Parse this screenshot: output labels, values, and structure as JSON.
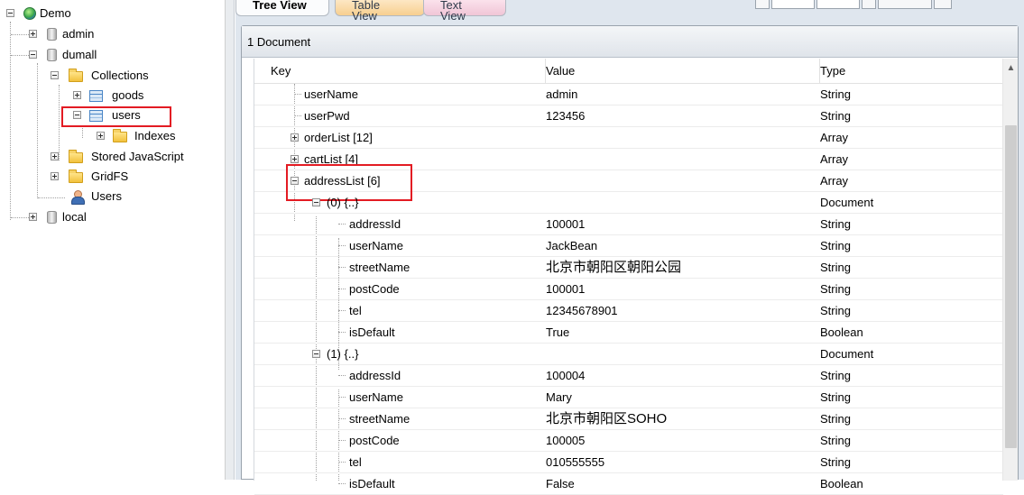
{
  "left_tree": {
    "root": "Demo",
    "admin": "admin",
    "dumall": "dumall",
    "collections": "Collections",
    "goods": "goods",
    "users": "users",
    "indexes": "Indexes",
    "stored_js": "Stored JavaScript",
    "gridfs": "GridFS",
    "users_node": "Users",
    "local": "local"
  },
  "tabs": {
    "tree_view": "Tree View",
    "table_view": "Table View",
    "text_view": "Text View"
  },
  "doc_count": "1 Document",
  "columns": {
    "key": "Key",
    "value": "Value",
    "type": "Type"
  },
  "rows": [
    {
      "key": "userName",
      "value": "admin",
      "type": "String"
    },
    {
      "key": "userPwd",
      "value": "123456",
      "type": "String"
    },
    {
      "key": "orderList [12]",
      "value": "",
      "type": "Array"
    },
    {
      "key": "cartList [4]",
      "value": "",
      "type": "Array"
    },
    {
      "key": "addressList [6]",
      "value": "",
      "type": "Array"
    },
    {
      "key": "(0) {..}",
      "value": "",
      "type": "Document"
    },
    {
      "key": "addressId",
      "value": "100001",
      "type": "String"
    },
    {
      "key": "userName",
      "value": "JackBean",
      "type": "String"
    },
    {
      "key": "streetName",
      "value": "北京市朝阳区朝阳公园",
      "type": "String"
    },
    {
      "key": "postCode",
      "value": "100001",
      "type": "String"
    },
    {
      "key": "tel",
      "value": "12345678901",
      "type": "String"
    },
    {
      "key": "isDefault",
      "value": "True",
      "type": "Boolean"
    },
    {
      "key": "(1) {..}",
      "value": "",
      "type": "Document"
    },
    {
      "key": "addressId",
      "value": "100004",
      "type": "String"
    },
    {
      "key": "userName",
      "value": "Mary",
      "type": "String"
    },
    {
      "key": "streetName",
      "value": "北京市朝阳区SOHO",
      "type": "String"
    },
    {
      "key": "postCode",
      "value": "100005",
      "type": "String"
    },
    {
      "key": "tel",
      "value": "010555555",
      "type": "String"
    },
    {
      "key": "isDefault",
      "value": "False",
      "type": "Boolean"
    }
  ]
}
